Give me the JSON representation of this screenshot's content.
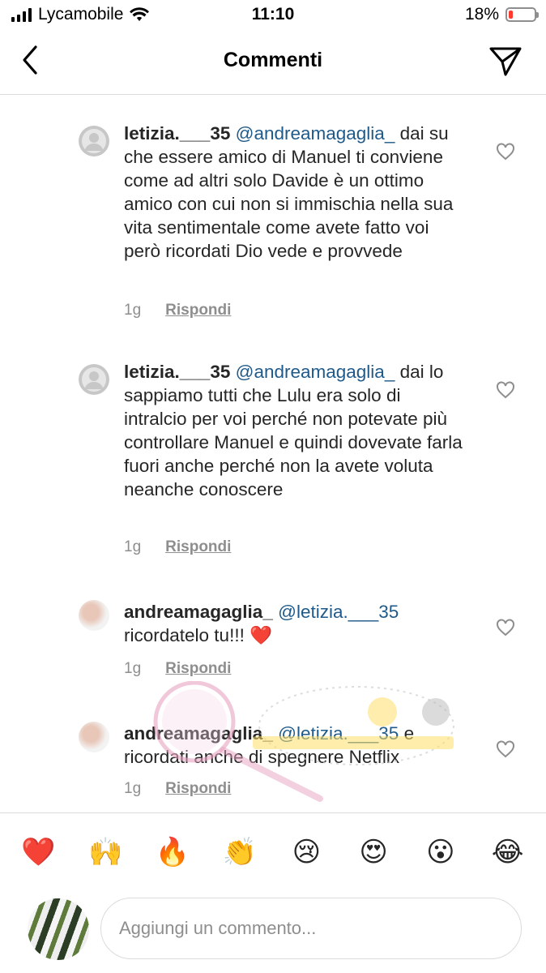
{
  "status_bar": {
    "carrier": "Lycamobile",
    "time": "11:10",
    "battery": "18%",
    "battery_level": 0.18,
    "battery_color": "#ff3b30"
  },
  "header": {
    "title": "Commenti",
    "back_icon": "chevron-left-icon",
    "send_icon": "paper-plane-icon"
  },
  "comments": [
    {
      "username": "letizia.___35",
      "mention": "@andreamagaglia_",
      "text": "dai su che essere amico di Manuel ti conviene come ad altri solo Davide è un ottimo amico con cui non si immischia nella sua vita sentimentale come avete fatto voi però ricordati Dio vede e provvede",
      "time": "1g",
      "reply": "Rispondi"
    },
    {
      "username": "letizia.___35",
      "mention": "@andreamagaglia_",
      "text": "dai lo sappiamo tutti che Lulu era solo di intralcio per voi perché non potevate più controllare Manuel e quindi dovevate farla fuori anche perché non la avete voluta neanche conoscere",
      "time": "1g",
      "reply": "Rispondi"
    },
    {
      "username": "andreamagaglia_",
      "mention": "@letizia.___35",
      "text": "ricordatelo tu!!! ❤️",
      "time": "1g",
      "reply": "Rispondi"
    },
    {
      "username": "andreamagaglia_",
      "mention": "@letizia.___35",
      "text": "e ricordati anche di spegnere Netflix",
      "time": "1g",
      "reply": "Rispondi"
    }
  ],
  "emoji_bar": [
    "❤️",
    "🙌",
    "🔥",
    "👏",
    "😢",
    "😍",
    "😮",
    "😂"
  ],
  "composer": {
    "placeholder": "Aggiungi un commento..."
  }
}
